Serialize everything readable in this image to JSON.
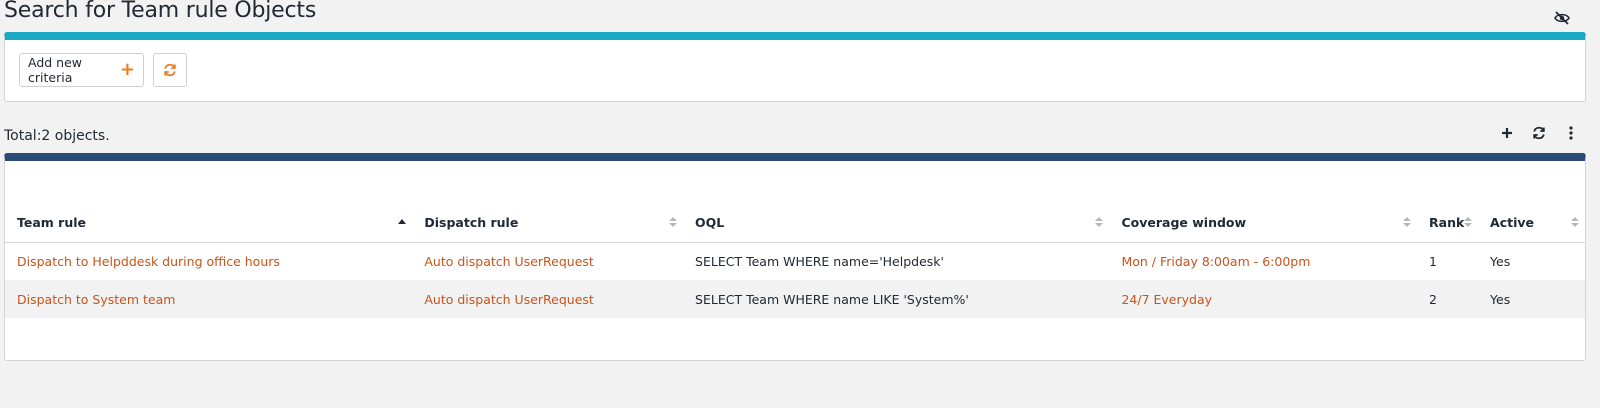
{
  "page": {
    "title": "Search for Team rule Objects"
  },
  "criteria": {
    "add_label": "Add new criteria"
  },
  "results": {
    "total_text": "Total:2 objects."
  },
  "table": {
    "columns": [
      "Team rule",
      "Dispatch rule",
      "OQL",
      "Coverage window",
      "Rank",
      "Active"
    ],
    "sorted_column": "Team rule",
    "rows": [
      {
        "team_rule": "Dispatch to Helpddesk during office hours",
        "dispatch_rule": "Auto dispatch UserRequest",
        "oql": "SELECT Team WHERE name='Helpdesk'",
        "coverage_window": "Mon / Friday 8:00am - 6:00pm",
        "rank": "1",
        "active": "Yes"
      },
      {
        "team_rule": "Dispatch to System team",
        "dispatch_rule": "Auto dispatch UserRequest",
        "oql": "SELECT Team WHERE name LIKE 'System%'",
        "coverage_window": "24/7 Everyday",
        "rank": "2",
        "active": "Yes"
      }
    ]
  },
  "colors": {
    "criteria_bar": "#1aa9c2",
    "results_bar": "#2c4b74",
    "link": "#c8541a",
    "accent": "#ea7d1e"
  },
  "icons": {
    "hide": "eye-slash-icon",
    "add": "plus-icon",
    "refresh": "refresh-icon",
    "menu": "vertical-dots-icon"
  }
}
